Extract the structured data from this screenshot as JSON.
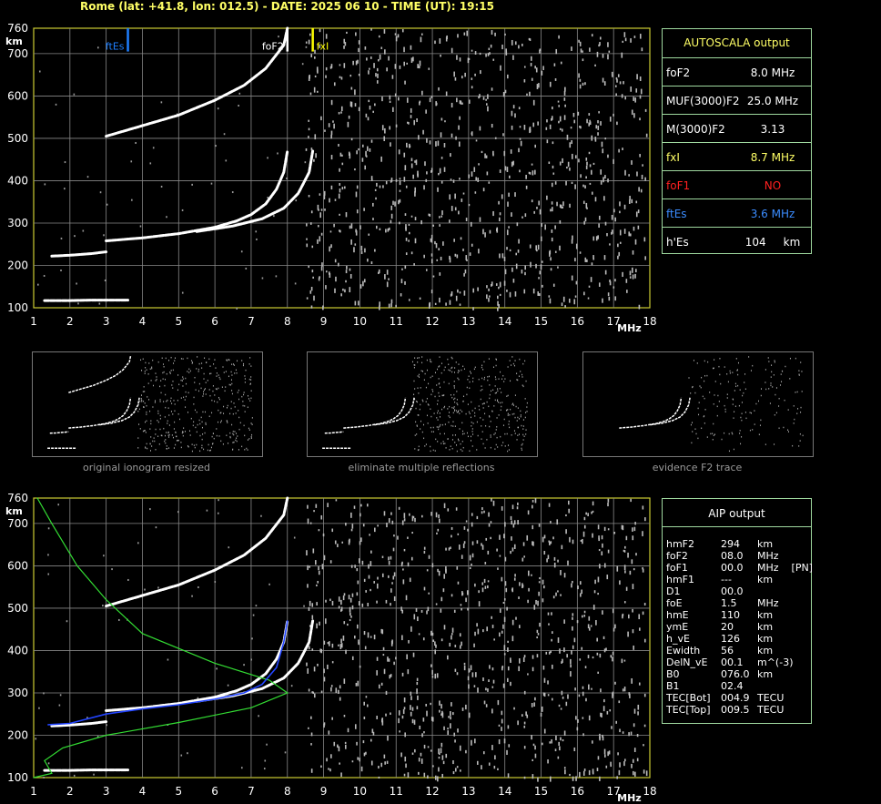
{
  "header": "Rome (lat: +41.8, lon: 012.5) - DATE: 2025 06 10 - TIME (UT): 19:15",
  "axis": {
    "y_ticks": [
      "100",
      "200",
      "300",
      "400",
      "500",
      "600",
      "700",
      "760"
    ],
    "y_unit": "km",
    "x_ticks": [
      "1",
      "2",
      "3",
      "4",
      "5",
      "6",
      "7",
      "8",
      "9",
      "10",
      "11",
      "12",
      "13",
      "14",
      "15",
      "16",
      "17",
      "18"
    ],
    "x_unit": "MHz"
  },
  "markers": [
    {
      "label": "ftEs",
      "freq": 3.6,
      "color": "#1e7fff"
    },
    {
      "label": "foF2",
      "freq": 8.0,
      "color": "#ffffff"
    },
    {
      "label": "fxI",
      "freq": 8.7,
      "color": "#ffff00"
    }
  ],
  "autoscala": {
    "title": "AUTOSCALA output",
    "rows": [
      {
        "key": "foF2",
        "value": "8.0 MHz",
        "color": "#ffffff"
      },
      {
        "key": "MUF(3000)F2",
        "value": "25.0 MHz",
        "color": "#ffffff"
      },
      {
        "key": "M(3000)F2",
        "value": "3.13",
        "color": "#ffffff"
      },
      {
        "key": "fxI",
        "value": "8.7 MHz",
        "color": "#ffff66"
      },
      {
        "key": "foF1",
        "value": "NO",
        "color": "#ff2020"
      },
      {
        "key": "ftEs",
        "value": "3.6 MHz",
        "color": "#3b8cff"
      },
      {
        "key": "h'Es",
        "value": "104     km",
        "color": "#ffffff"
      }
    ]
  },
  "thumbnails": [
    {
      "caption": "original ionogram resized"
    },
    {
      "caption": "eliminate multiple reflections"
    },
    {
      "caption": "evidence F2 trace"
    }
  ],
  "aip": {
    "title": "AIP output",
    "rows": [
      {
        "k": "hmF2",
        "v": "294",
        "u": "km"
      },
      {
        "k": "foF2",
        "v": "08.0",
        "u": "MHz"
      },
      {
        "k": "foF1",
        "v": "00.0",
        "u": "MHz    [PN]"
      },
      {
        "k": "hmF1",
        "v": "---",
        "u": "km"
      },
      {
        "k": "D1",
        "v": "00.0",
        "u": ""
      },
      {
        "k": "foE",
        "v": "1.5",
        "u": "MHz"
      },
      {
        "k": "hmE",
        "v": "110",
        "u": "km"
      },
      {
        "k": "ymE",
        "v": "20",
        "u": "km"
      },
      {
        "k": "h_vE",
        "v": "126",
        "u": "km"
      },
      {
        "k": "Ewidth",
        "v": "56",
        "u": "km"
      },
      {
        "k": "DelN_vE",
        "v": "00.1",
        "u": "m^(-3)"
      },
      {
        "k": "B0",
        "v": "076.0",
        "u": "km"
      },
      {
        "k": "B1",
        "v": "02.4",
        "u": ""
      },
      {
        "k": "TEC[Bot]",
        "v": "004.9",
        "u": "TECU"
      },
      {
        "k": "TEC[Top]",
        "v": "009.5",
        "u": "TECU"
      }
    ]
  },
  "chart_data": [
    {
      "type": "scatter",
      "title": "Rome (lat: +41.8, lon: 012.5) - DATE: 2025 06 10 - TIME (UT): 19:15",
      "xlabel": "MHz",
      "ylabel": "km",
      "xlim": [
        1,
        18
      ],
      "ylim": [
        100,
        760
      ],
      "grid": true,
      "series": [
        {
          "name": "Es",
          "color": "#ffffff",
          "x": [
            1.3,
            2.0,
            2.6,
            3.2,
            3.6
          ],
          "y": [
            117,
            117,
            118,
            118,
            118
          ]
        },
        {
          "name": "E",
          "color": "#ffffff",
          "x": [
            1.5,
            2.0,
            2.6,
            3.0
          ],
          "y": [
            222,
            224,
            228,
            232
          ]
        },
        {
          "name": "F2-O",
          "color": "#ffffff",
          "x": [
            3.0,
            4.0,
            5.0,
            6.0,
            6.6,
            7.0,
            7.4,
            7.7,
            7.9,
            8.0
          ],
          "y": [
            258,
            265,
            275,
            290,
            305,
            320,
            345,
            380,
            420,
            470
          ]
        },
        {
          "name": "F2-X",
          "color": "#ffffff",
          "x": [
            5.5,
            6.5,
            7.3,
            7.9,
            8.3,
            8.6,
            8.7
          ],
          "y": [
            280,
            293,
            310,
            335,
            370,
            420,
            470
          ]
        },
        {
          "name": "F2-multiple",
          "color": "#ffffff",
          "x": [
            3.0,
            4.0,
            5.0,
            6.0,
            6.8,
            7.4,
            7.9,
            8.0
          ],
          "y": [
            505,
            530,
            555,
            590,
            625,
            665,
            720,
            760
          ]
        }
      ]
    },
    {
      "type": "line",
      "title": "AIP output",
      "xlabel": "MHz",
      "ylabel": "km",
      "xlim": [
        1,
        18
      ],
      "ylim": [
        100,
        760
      ],
      "grid": true,
      "series": [
        {
          "name": "profile",
          "color": "#33dd33",
          "x": [
            1.0,
            1.5,
            1.3,
            1.8,
            3.0,
            5.0,
            7.0,
            8.0,
            7.5,
            6.0,
            4.0,
            3.0,
            2.2,
            1.5,
            1.1
          ],
          "y": [
            100,
            110,
            140,
            170,
            200,
            230,
            265,
            300,
            330,
            370,
            440,
            520,
            600,
            700,
            760
          ]
        },
        {
          "name": "true-height",
          "color": "#2244ff",
          "x": [
            1.4,
            2.0,
            3.0,
            4.0,
            5.0,
            6.0,
            6.8,
            7.3,
            7.7,
            7.9,
            8.0
          ],
          "y": [
            225,
            228,
            250,
            262,
            272,
            285,
            300,
            320,
            360,
            420,
            470
          ]
        }
      ]
    }
  ]
}
